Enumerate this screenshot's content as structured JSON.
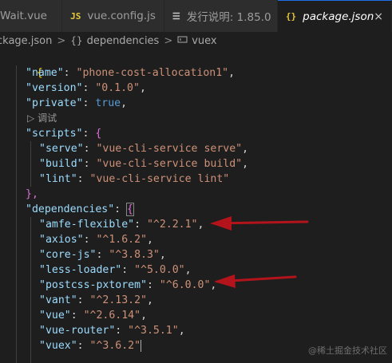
{
  "tabs": [
    {
      "label": "Wait.vue",
      "icon": "vue-file-icon"
    },
    {
      "label": "vue.config.js",
      "icon_text": "JS"
    },
    {
      "label": "发行说明: 1.85.0",
      "icon_text": "☰"
    },
    {
      "label": "package.json",
      "icon_text": "{}",
      "close": "×"
    }
  ],
  "breadcrumb": {
    "items": [
      "ckage.json",
      "dependencies",
      "vuex"
    ],
    "separator": ">",
    "object_icon_text": "{}"
  },
  "code": {
    "open_brace": "{",
    "close_brace_scripts": "},",
    "codelens": "调试",
    "codelens_icon": "▷",
    "entries": [
      {
        "key": "\"name\"",
        "value": "\"phone-cost-allocation1\""
      },
      {
        "key": "\"version\"",
        "value": "\"0.1.0\""
      },
      {
        "key": "\"private\"",
        "value": "true"
      },
      {
        "key": "\"scripts\"",
        "value": "{"
      },
      {
        "key": "\"serve\"",
        "value": "\"vue-cli-service serve\""
      },
      {
        "key": "\"build\"",
        "value": "\"vue-cli-service build\""
      },
      {
        "key": "\"lint\"",
        "value": "\"vue-cli-service lint\""
      },
      {
        "key": "\"dependencies\"",
        "value": "{"
      },
      {
        "key": "\"amfe-flexible\"",
        "value": "\"^2.2.1\""
      },
      {
        "key": "\"axios\"",
        "value": "\"^1.6.2\""
      },
      {
        "key": "\"core-js\"",
        "value": "\"^3.8.3\""
      },
      {
        "key": "\"less-loader\"",
        "value": "\"^5.0.0\""
      },
      {
        "key": "\"postcss-pxtorem\"",
        "value": "\"^6.0.0\""
      },
      {
        "key": "\"vant\"",
        "value": "\"^2.13.2\""
      },
      {
        "key": "\"vue\"",
        "value": "\"^2.6.14\""
      },
      {
        "key": "\"vue-router\"",
        "value": "\"^3.5.1\""
      },
      {
        "key": "\"vuex\"",
        "value": "\"^3.6.2\""
      }
    ]
  },
  "watermark": "@稀土掘金技术社区",
  "colors": {
    "arrow": "#b3131b",
    "key": "#9cdcfe",
    "string": "#ce9178",
    "boolean": "#569cd6"
  }
}
